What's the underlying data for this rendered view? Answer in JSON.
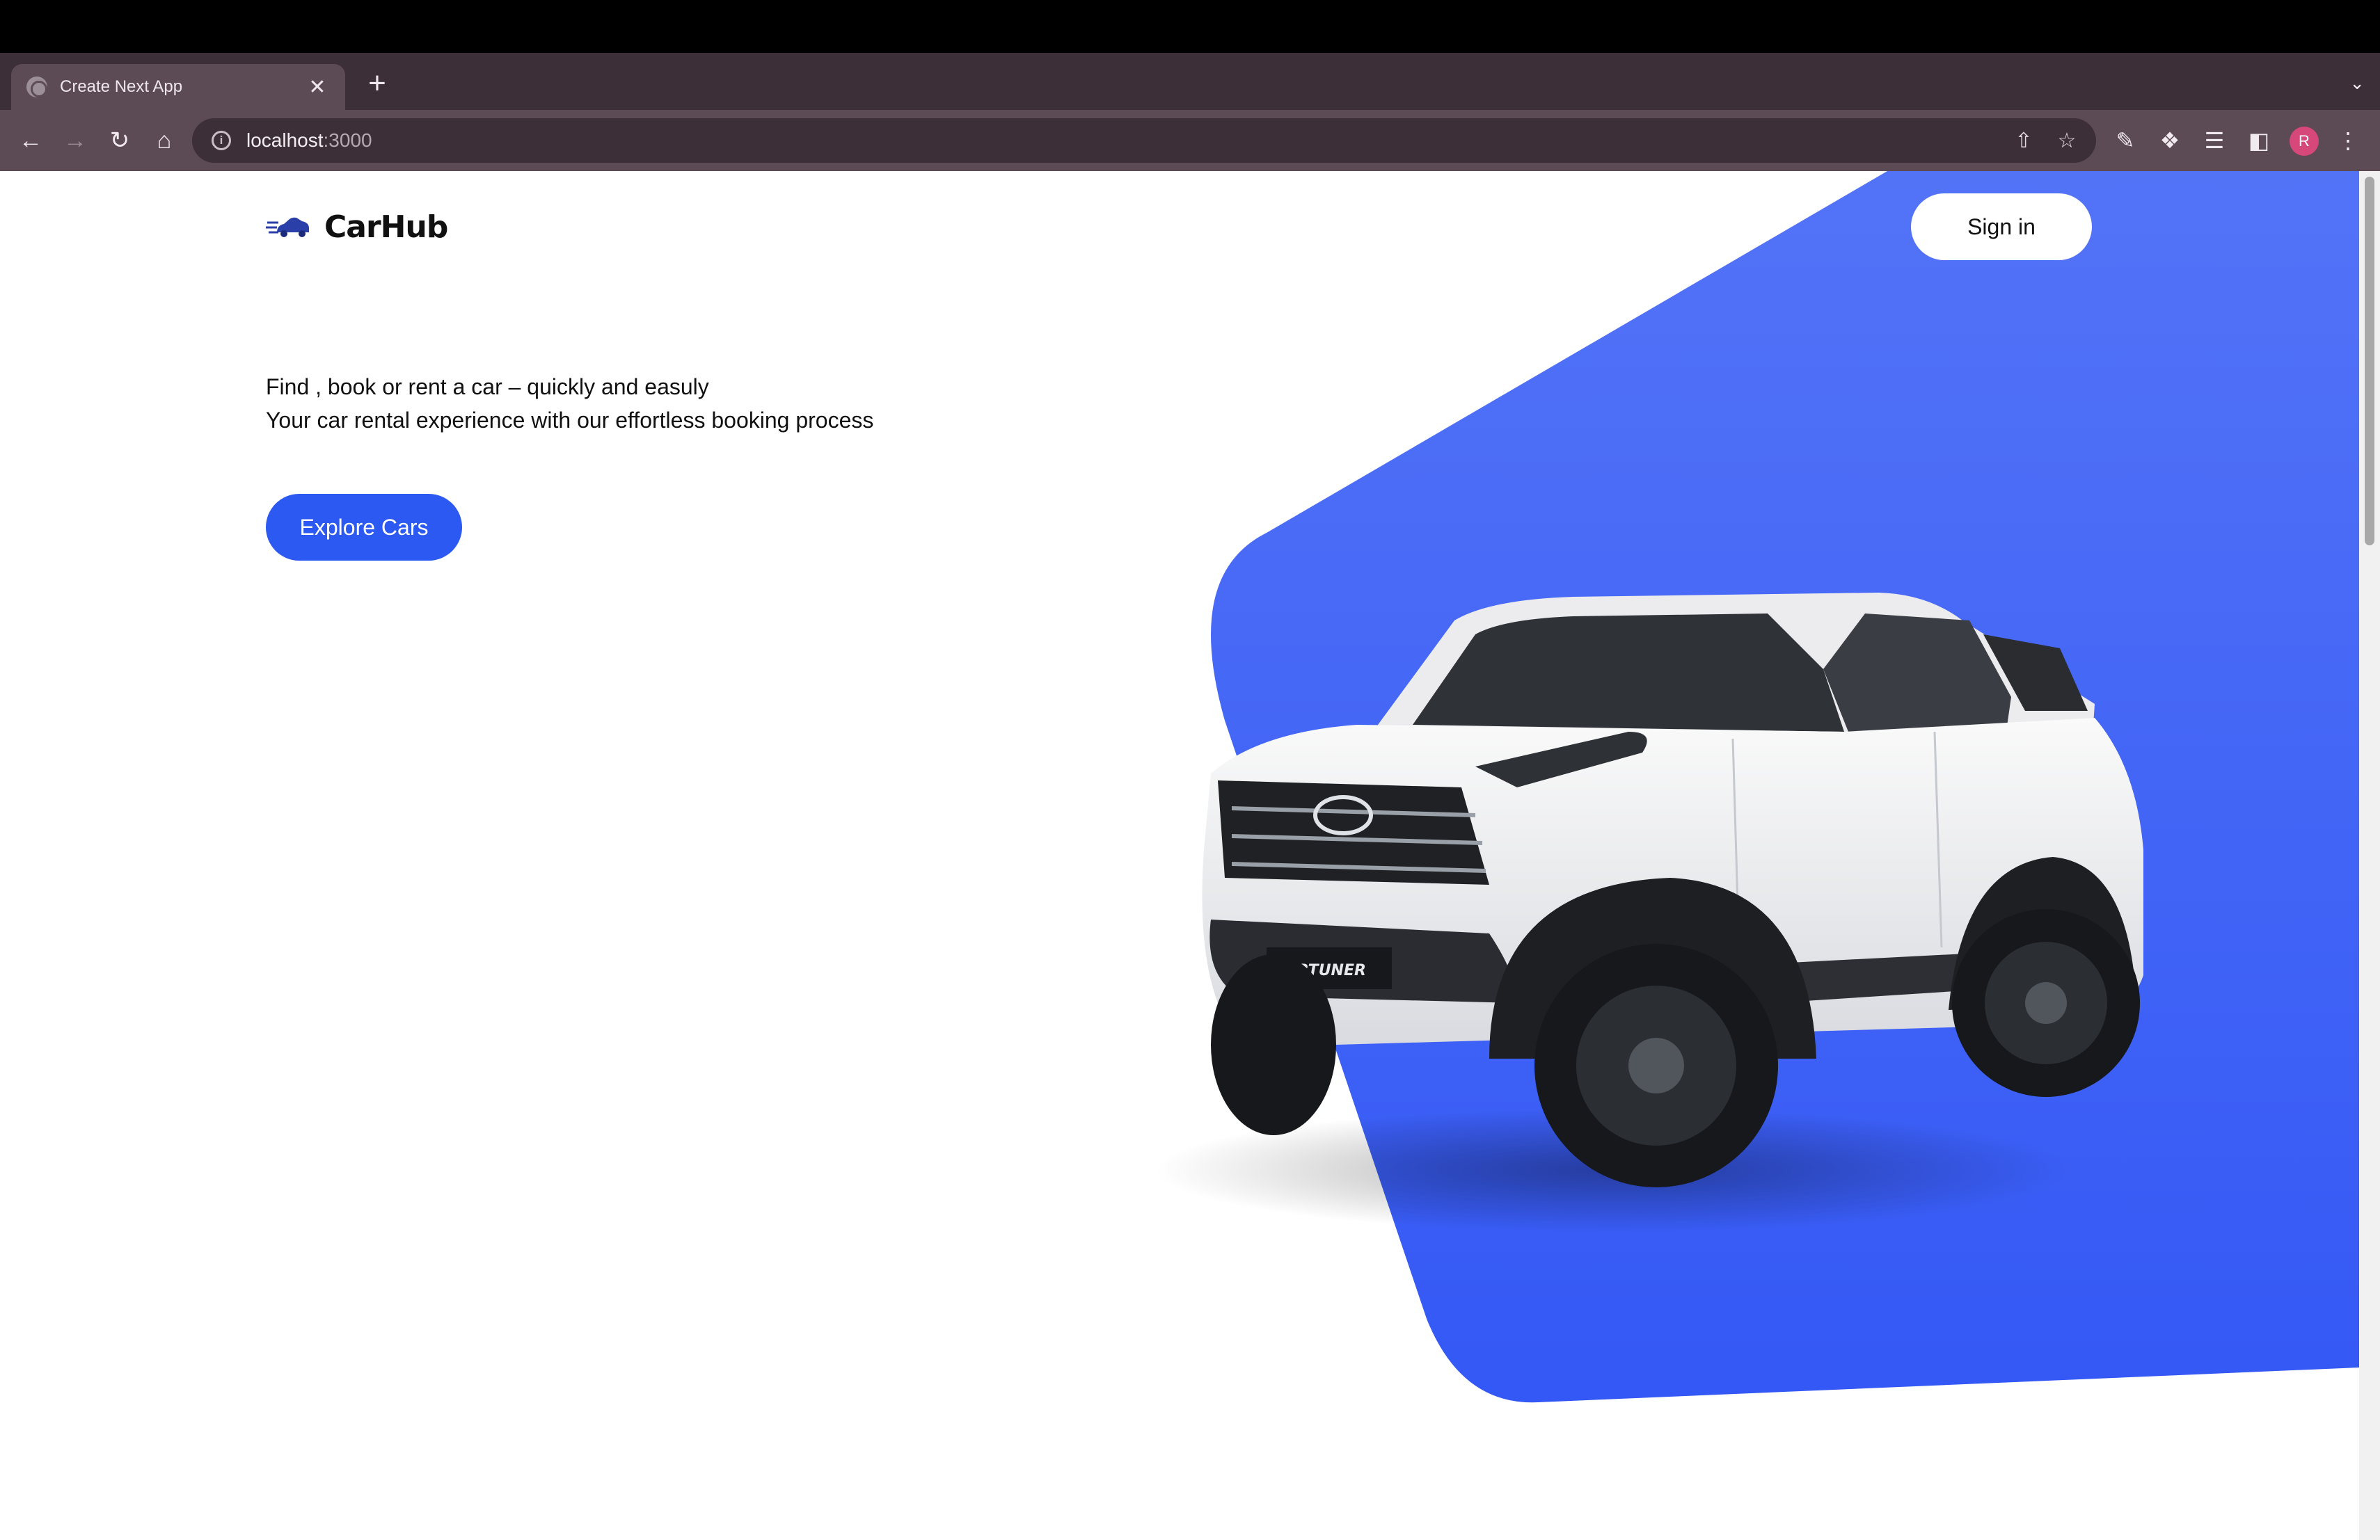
{
  "browser": {
    "tab_title": "Create Next App",
    "new_tab_symbol": "+",
    "close_symbol": "✕",
    "url_host": "localhost",
    "url_port": ":3000",
    "profile_initial": "R"
  },
  "site": {
    "logo_text": "CarHub",
    "signin_label": "Sign in",
    "tagline_line1": "Find , book or rent a car – quickly and easuly",
    "tagline_line2": "Your car rental experience with our effortless booking process",
    "explore_label": "Explore Cars"
  },
  "colors": {
    "accent": "#2b59f2",
    "hero_blue_light": "#5373f7",
    "hero_blue_dark": "#3458f5",
    "chrome_dark": "#3c2f38",
    "chrome_toolbar": "#5c4a55"
  }
}
